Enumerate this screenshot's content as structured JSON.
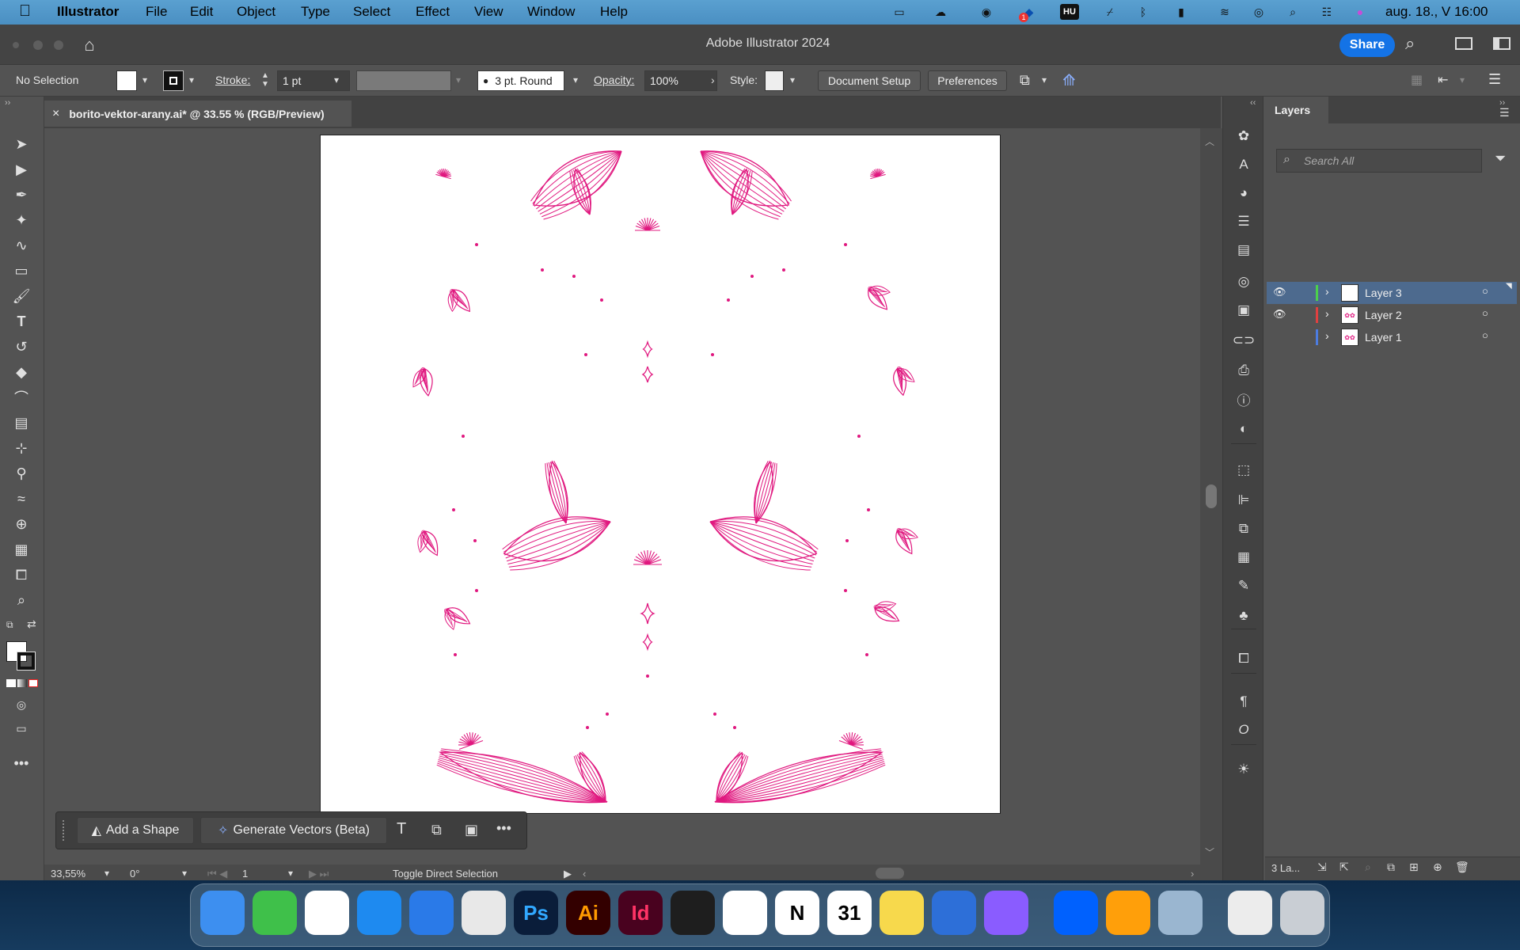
{
  "menubar": {
    "apple_icon": "apple-icon",
    "app_name": "Illustrator",
    "items": [
      "File",
      "Edit",
      "Object",
      "Type",
      "Select",
      "Effect",
      "View",
      "Window",
      "Help"
    ],
    "input_source": "HU",
    "notification_badge": "1",
    "clock": "aug. 18., V 16:00"
  },
  "titlebar": {
    "title": "Adobe Illustrator 2024",
    "share_label": "Share"
  },
  "control": {
    "selection": "No Selection",
    "stroke_label": "Stroke:",
    "stroke_value": "1 pt",
    "brush_value": "3 pt. Round",
    "opacity_label": "Opacity:",
    "opacity_value": "100%",
    "style_label": "Style:",
    "doc_setup_label": "Document Setup",
    "preferences_label": "Preferences"
  },
  "document": {
    "tab_title": "borito-vektor-arany.ai* @ 33.55 % (RGB/Preview)",
    "close_glyph": "×"
  },
  "art_color": "#e0187f",
  "layers_panel": {
    "title": "Layers",
    "search_placeholder": "Search All",
    "layers": [
      {
        "name": "Layer 3",
        "color": "#4cd04c",
        "selected": true
      },
      {
        "name": "Layer 2",
        "color": "#e04040",
        "selected": false
      },
      {
        "name": "Layer 1",
        "color": "#4c7ce0",
        "selected": false
      }
    ],
    "footer_count": "3 La..."
  },
  "context_bar": {
    "add_shape_label": "Add a Shape",
    "generate_label": "Generate Vectors (Beta)"
  },
  "status": {
    "zoom": "33,55%",
    "rotation": "0°",
    "artboard_num": "1",
    "tool_hint": "Toggle Direct Selection"
  },
  "dock": {
    "apps": [
      {
        "name": "finder",
        "label": "",
        "bg": "#3d8ff0"
      },
      {
        "name": "messages",
        "label": "",
        "bg": "#3fc04a"
      },
      {
        "name": "chrome",
        "label": "",
        "bg": "#ffffff"
      },
      {
        "name": "safari",
        "label": "",
        "bg": "#1e8af0"
      },
      {
        "name": "mail-client",
        "label": "",
        "bg": "#2a7ae8"
      },
      {
        "name": "launchpad",
        "label": "",
        "bg": "#e8e8e8"
      },
      {
        "name": "photoshop",
        "label": "Ps",
        "bg": "#0a1d3a",
        "fg": "#31a8ff"
      },
      {
        "name": "illustrator",
        "label": "Ai",
        "bg": "#330000",
        "fg": "#ff9a00"
      },
      {
        "name": "indesign",
        "label": "Id",
        "bg": "#49021f",
        "fg": "#ff3366"
      },
      {
        "name": "figma",
        "label": "",
        "bg": "#1e1e1e"
      },
      {
        "name": "capcut",
        "label": "",
        "bg": "#ffffff"
      },
      {
        "name": "notion",
        "label": "N",
        "bg": "#ffffff",
        "fg": "#000000"
      },
      {
        "name": "calendar",
        "label": "31",
        "bg": "#ffffff",
        "fg": "#000000"
      },
      {
        "name": "notes",
        "label": "",
        "bg": "#f7d94c"
      },
      {
        "name": "preview-app",
        "label": "",
        "bg": "#2d6fd8"
      },
      {
        "name": "messenger",
        "label": "",
        "bg": "#8a5cff"
      },
      {
        "name": "dropbox",
        "label": "",
        "bg": "#0061fe"
      },
      {
        "name": "pages",
        "label": "",
        "bg": "#ff9f0a"
      },
      {
        "name": "image-app",
        "label": "",
        "bg": "#9ab6d0"
      },
      {
        "name": "recent-file",
        "label": "",
        "bg": "#ececec"
      },
      {
        "name": "trash",
        "label": "",
        "bg": "#c9ced4"
      }
    ]
  }
}
